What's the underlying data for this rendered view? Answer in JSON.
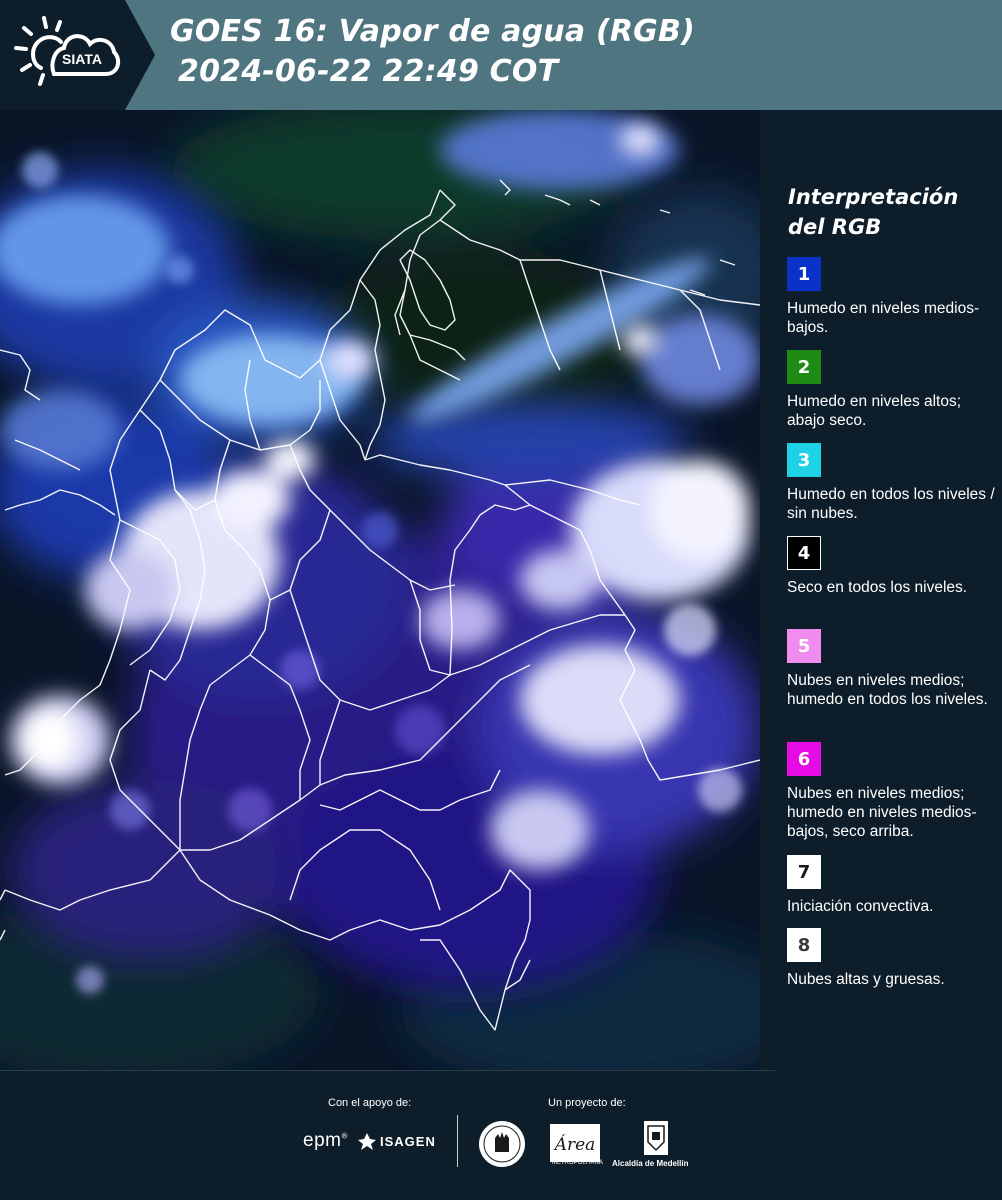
{
  "header": {
    "logo_text": "SIATA",
    "title_line1": "GOES 16: Vapor de agua (RGB)",
    "title_line2": "2024-06-22 22:49 COT"
  },
  "legend": {
    "title": "Interpretación del RGB",
    "items": [
      {
        "number": "1",
        "color": "#0a32c8",
        "text_color": "#ffffff",
        "text": "Humedo en niveles medios-bajos."
      },
      {
        "number": "2",
        "color": "#1e8c14",
        "text_color": "#ffffff",
        "text": "Humedo en niveles altos; abajo seco."
      },
      {
        "number": "3",
        "color": "#1ed2e6",
        "text_color": "#ffffff",
        "text": "Humedo en todos los niveles / sin nubes."
      },
      {
        "number": "4",
        "color": "#000000",
        "text_color": "#ffffff",
        "text": "Seco en todos los niveles."
      },
      {
        "number": "5",
        "color": "#f08cf0",
        "text_color": "#ffffff",
        "text": "Nubes en niveles medios; humedo en todos los niveles."
      },
      {
        "number": "6",
        "color": "#e60ae6",
        "text_color": "#ffffff",
        "text": "Nubes en niveles medios; humedo en niveles medios-bajos, seco arriba."
      },
      {
        "number": "7",
        "color": "#ffffff",
        "text_color": "#1a1a1a",
        "text": "Iniciación convectiva."
      },
      {
        "number": "8",
        "color": "#ffffff",
        "text_color": "#3a3a3a",
        "text": "Nubes altas y gruesas."
      }
    ]
  },
  "footer": {
    "support_label": "Con el apoyo de:",
    "project_label": "Un proyecto de:",
    "epm_text": "epm",
    "isagen_text": "ISAGEN",
    "area_text": "Área",
    "area_sub": "METROPOLITANA",
    "alcaldia_text": "Alcaldía de Medellín"
  }
}
